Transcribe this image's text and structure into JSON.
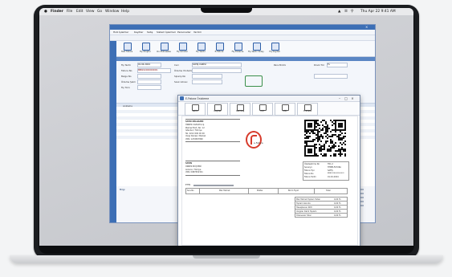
{
  "mac_menubar": {
    "items": [
      "Finder",
      "File",
      "Edit",
      "View",
      "Go",
      "Window",
      "Help"
    ],
    "clock": "Thu Apr 22 9:41 AM"
  },
  "app": {
    "window_title": "",
    "menu": [
      "Hızlı İşlemler",
      "Kayıtlar",
      "Satış",
      "Sistem İşlemleri",
      "Personeller",
      "Yardım"
    ],
    "ribbon": [
      "Hızlı Fatura",
      "Fiş Oluştur",
      "Ön Muhasebe",
      "Fiş Gönder",
      "Fiş Yazdır",
      "E-Fatura",
      "Fiş Düzenle",
      "Fiş Yazdır Kolay",
      "Fiş Kaydet"
    ],
    "form": {
      "labels": [
        "Fiş Tarihi",
        "Fatura No",
        "Belge No",
        "Ödeme Şekli",
        "Fiş Türü",
        "Cari",
        "Ödeme Yöntemi",
        "Sipariş No",
        "Sevk Adresi",
        "Para Birimi"
      ],
      "date_value": "01.04.2024",
      "invoice_value": "BBB2024000000001",
      "cari_value": "SATIŞ CARİSİ",
      "currency_label": "Döviz Tür",
      "currency_value": "TL"
    },
    "grid_note": "Açıklama",
    "summary": {
      "label": "Bilgi",
      "values": [
        "0,00",
        "0,00",
        "0,00",
        "0,00",
        "0,00"
      ]
    }
  },
  "dialog": {
    "title": "E-Fatura Önizleme",
    "tools": [
      "Yazdır",
      "Kaydet",
      "Yakınlaş",
      "PDF",
      "XML",
      "E-Posta"
    ],
    "doc": {
      "seller_heading": "SATICI BİLGİLERİ",
      "seller_lines": [
        "ÖRNEK YAZILIM A.Ş.",
        "Merkez Mah. No: 12",
        "İstanbul / Türkiye",
        "Tel: 0212 000 00 00",
        "Vergi Dairesi: Merkez",
        "VKN: 1234567890"
      ],
      "logo_text": "e-Fatura",
      "buyer_heading": "SAYIN",
      "buyer_lines": [
        "ÖRNEK MÜŞTERİ",
        "Ankara / Türkiye",
        "VKN: 0987654321"
      ],
      "ettn_label": "ETTN",
      "meta_rows": [
        {
          "k": "Özelleştirme No",
          "v": "TR1.2"
        },
        {
          "k": "Senaryo",
          "v": "TEMELFATURA"
        },
        {
          "k": "Fatura Tipi",
          "v": "SATIŞ"
        },
        {
          "k": "Fatura No",
          "v": "BBB2024000000001"
        },
        {
          "k": "Fatura Tarihi",
          "v": "01.04.2024"
        }
      ],
      "table_headers": [
        "Sıra No",
        "Mal Hizmet",
        "Miktar",
        "Birim Fiyat",
        "Tutar"
      ],
      "totals": [
        {
          "k": "Mal Hizmet Toplam Tutarı",
          "v": "0,00 TL"
        },
        {
          "k": "Toplam İskonto",
          "v": "0,00 TL"
        },
        {
          "k": "Hesaplanan KDV",
          "v": "0,00 TL"
        },
        {
          "k": "Vergiler Dahil Toplam",
          "v": "0,00 TL"
        },
        {
          "k": "Ödenecek Tutar",
          "v": "0,00 TL"
        }
      ]
    }
  }
}
